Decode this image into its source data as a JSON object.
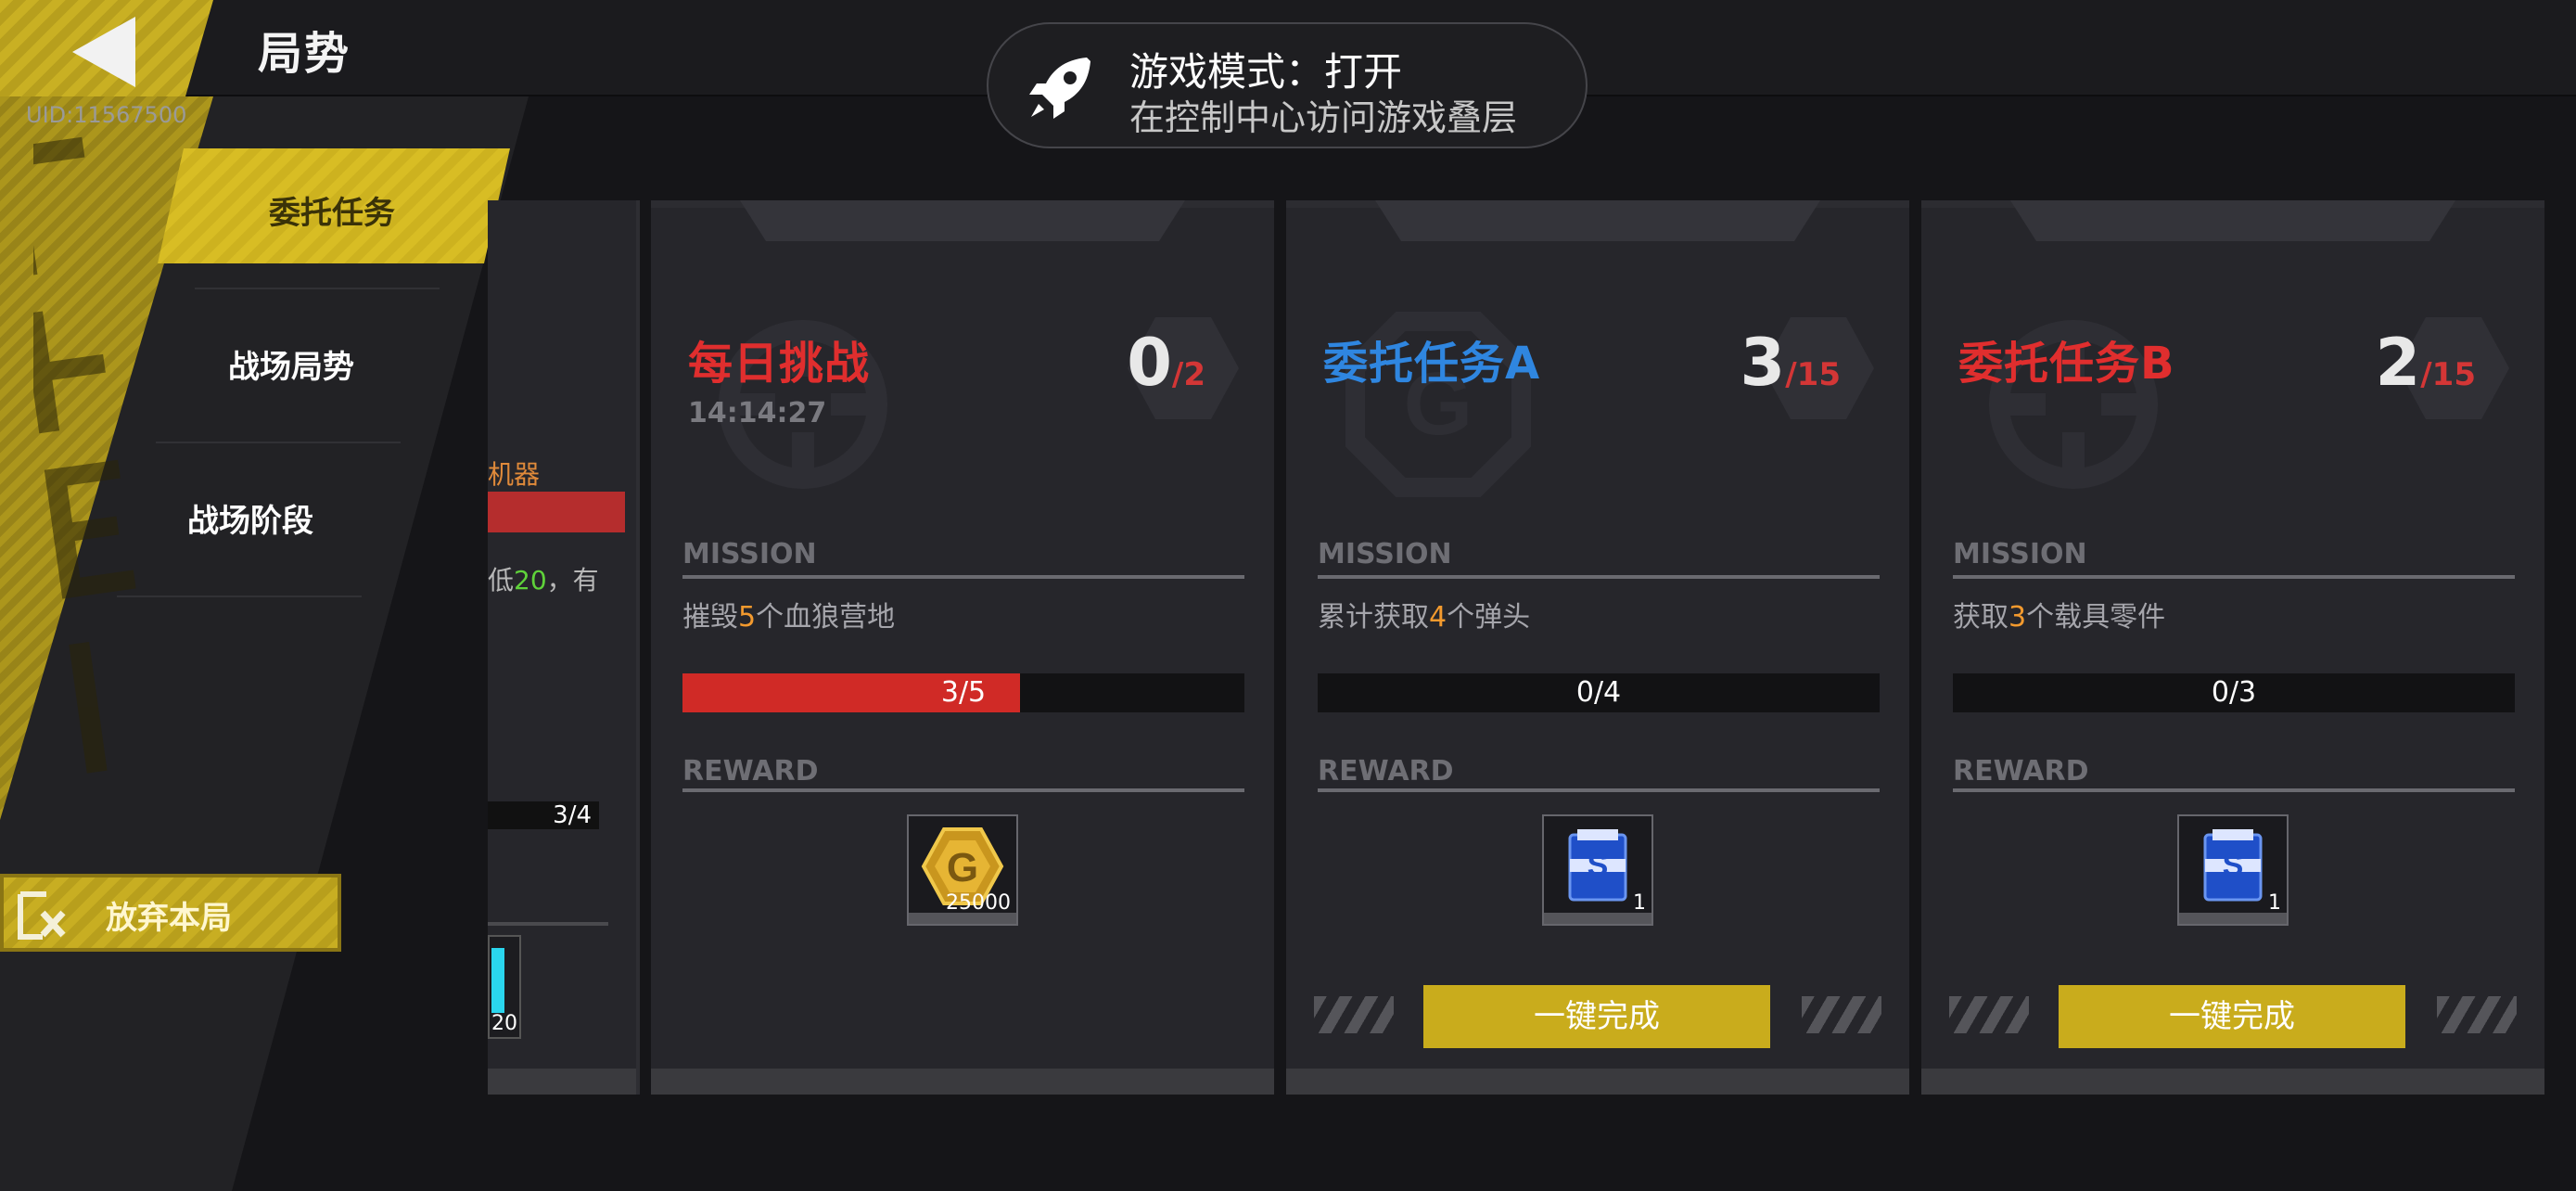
{
  "header": {
    "title": "局势",
    "uid": "UID:11567500"
  },
  "toast": {
    "title": "游戏模式：打开",
    "subtitle": "在控制中心访问游戏叠层"
  },
  "sidebar": {
    "items": [
      {
        "label": "委托任务",
        "active": true
      },
      {
        "label": "战场局势",
        "active": false
      },
      {
        "label": "战场阶段",
        "active": false
      }
    ],
    "abandon_label": "放弃本局"
  },
  "partial_card": {
    "label": "机器",
    "text_prefix": "低",
    "text_value": "20",
    "text_suffix": "，有",
    "progress": "3/4",
    "item_qty": "20"
  },
  "cards": [
    {
      "title": "每日挑战",
      "title_color": "#e02e2e",
      "timer": "14:14:27",
      "count": "0",
      "total": "/2",
      "mission_label": "MISSION",
      "desc_prefix": "摧毁",
      "desc_value": "5",
      "desc_suffix": "个血狼营地",
      "progress_text": "3/5",
      "progress_fraction": 0.6,
      "reward_label": "REWARD",
      "reward_icon": "gold-coin-icon",
      "reward_qty": "25000"
    },
    {
      "title": "委托任务A",
      "title_color": "#2f86e0",
      "count": "3",
      "total": "/15",
      "mission_label": "MISSION",
      "desc_prefix": "累计获取",
      "desc_value": "4",
      "desc_suffix": "个弹头",
      "progress_text": "0/4",
      "progress_fraction": 0,
      "reward_label": "REWARD",
      "reward_icon": "supply-box-icon",
      "reward_qty": "1",
      "button_label": "一键完成"
    },
    {
      "title": "委托任务B",
      "title_color": "#e02e2e",
      "count": "2",
      "total": "/15",
      "mission_label": "MISSION",
      "desc_prefix": "获取",
      "desc_value": "3",
      "desc_suffix": "个载具零件",
      "progress_text": "0/3",
      "progress_fraction": 0,
      "reward_label": "REWARD",
      "reward_icon": "supply-box-icon",
      "reward_qty": "1",
      "button_label": "一键完成"
    }
  ]
}
